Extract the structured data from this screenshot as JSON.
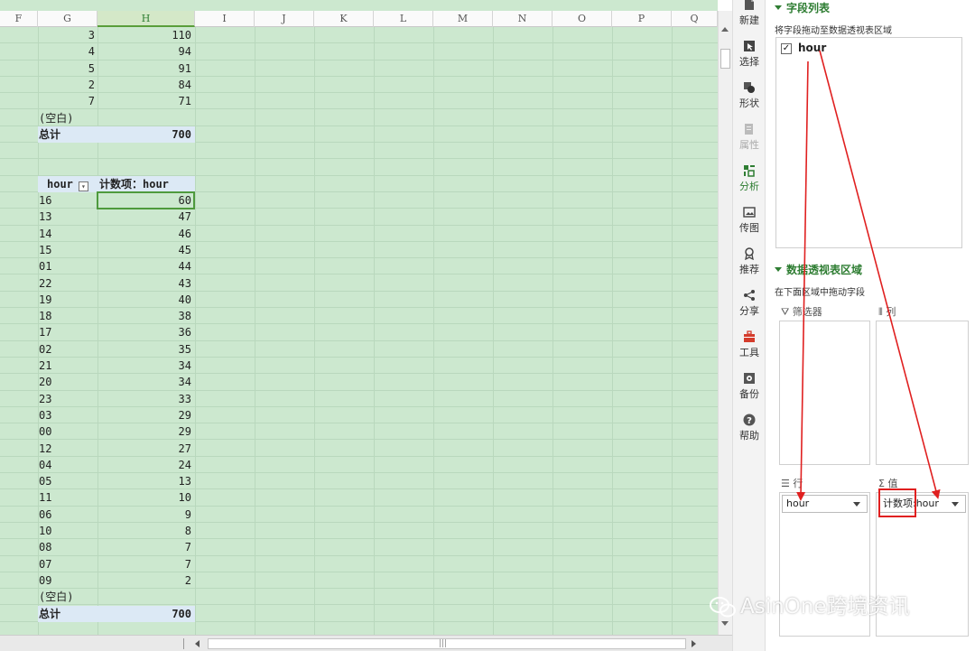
{
  "columns": [
    "F",
    "G",
    "H",
    "I",
    "J",
    "K",
    "L",
    "M",
    "N",
    "O",
    "P",
    "Q"
  ],
  "selected_column": "H",
  "pivot1": {
    "rows": [
      {
        "g": "3",
        "h": "110"
      },
      {
        "g": "4",
        "h": "94"
      },
      {
        "g": "5",
        "h": "91"
      },
      {
        "g": "2",
        "h": "84"
      },
      {
        "g": "7",
        "h": "71"
      }
    ],
    "blank_label": "(空白)",
    "total_label": "总计",
    "total_value": "700"
  },
  "pivot2": {
    "row_header": "hour",
    "value_header": "计数项：hour",
    "rows": [
      {
        "g": "16",
        "h": "60"
      },
      {
        "g": "13",
        "h": "47"
      },
      {
        "g": "14",
        "h": "46"
      },
      {
        "g": "15",
        "h": "45"
      },
      {
        "g": "01",
        "h": "44"
      },
      {
        "g": "22",
        "h": "43"
      },
      {
        "g": "19",
        "h": "40"
      },
      {
        "g": "18",
        "h": "38"
      },
      {
        "g": "17",
        "h": "36"
      },
      {
        "g": "02",
        "h": "35"
      },
      {
        "g": "21",
        "h": "34"
      },
      {
        "g": "20",
        "h": "34"
      },
      {
        "g": "23",
        "h": "33"
      },
      {
        "g": "03",
        "h": "29"
      },
      {
        "g": "00",
        "h": "29"
      },
      {
        "g": "12",
        "h": "27"
      },
      {
        "g": "04",
        "h": "24"
      },
      {
        "g": "05",
        "h": "13"
      },
      {
        "g": "11",
        "h": "10"
      },
      {
        "g": "06",
        "h": "9"
      },
      {
        "g": "10",
        "h": "8"
      },
      {
        "g": "08",
        "h": "7"
      },
      {
        "g": "07",
        "h": "7"
      },
      {
        "g": "09",
        "h": "2"
      }
    ],
    "blank_label": "(空白)",
    "total_label": "总计",
    "total_value": "700"
  },
  "toolbar": {
    "items": [
      {
        "label": "新建",
        "icon": "new-icon"
      },
      {
        "label": "选择",
        "icon": "select-icon"
      },
      {
        "label": "形状",
        "icon": "shape-icon"
      },
      {
        "label": "属性",
        "icon": "properties-icon"
      },
      {
        "label": "分析",
        "icon": "analysis-icon"
      },
      {
        "label": "传图",
        "icon": "image-upload-icon"
      },
      {
        "label": "推荐",
        "icon": "recommend-icon"
      },
      {
        "label": "分享",
        "icon": "share-icon"
      },
      {
        "label": "工具",
        "icon": "toolbox-icon"
      },
      {
        "label": "备份",
        "icon": "backup-icon"
      },
      {
        "label": "帮助",
        "icon": "help-icon"
      }
    ]
  },
  "panel": {
    "field_list_title": "字段列表",
    "field_list_hint": "将字段拖动至数据透视表区域",
    "field": {
      "name": "hour",
      "checked": true
    },
    "areas_title": "数据透视表区域",
    "areas_hint": "在下面区域中拖动字段",
    "filter_label": "筛选器",
    "column_label": "列",
    "row_label": "行",
    "values_label": "值",
    "row_field": "hour",
    "value_field": "计数项:hour"
  },
  "watermark": "AsinOne跨境资讯",
  "colors": {
    "sheet_bg": "#cce8cf",
    "accent": "#2e7d32",
    "annotation": "#e02020",
    "total_bg": "#dce9f5"
  }
}
